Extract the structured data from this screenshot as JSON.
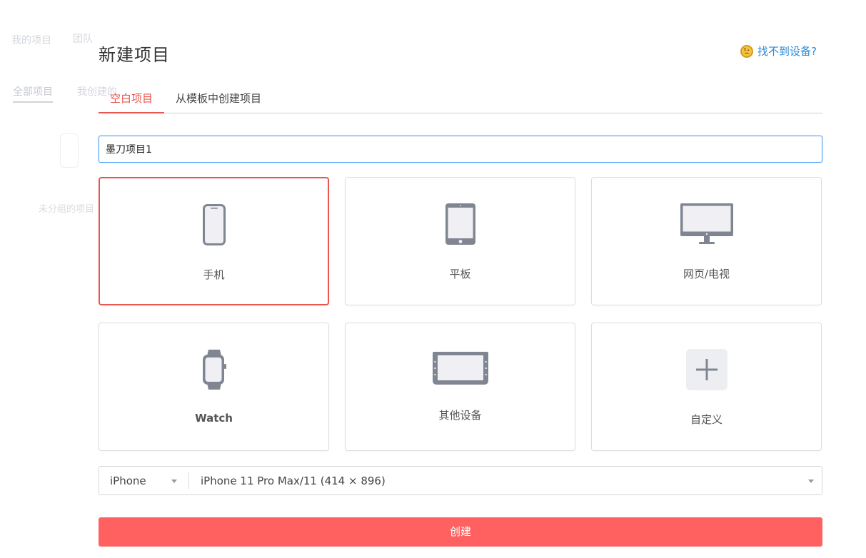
{
  "background": {
    "blurred_text_1": "我的项目",
    "blurred_text_2": "团队",
    "blurred_tab_1": "全部项目",
    "blurred_tab_2": "我创建的",
    "blurred_text_3": "未分组的项目"
  },
  "modal": {
    "title": "新建项目",
    "help_link": "找不到设备?",
    "help_icon": "thinking-face-emoji-icon"
  },
  "tabs": [
    {
      "label": "空白项目",
      "active": true
    },
    {
      "label": "从模板中创建项目",
      "active": false
    }
  ],
  "project_name": {
    "value": "墨刀项目1"
  },
  "devices": [
    {
      "label": "手机",
      "icon": "phone-icon",
      "selected": true
    },
    {
      "label": "平板",
      "icon": "tablet-icon",
      "selected": false
    },
    {
      "label": "网页/电视",
      "icon": "monitor-icon",
      "selected": false
    },
    {
      "label": "Watch",
      "icon": "watch-icon",
      "selected": false
    },
    {
      "label": "其他设备",
      "icon": "car-display-icon",
      "selected": false
    },
    {
      "label": "自定义",
      "icon": "plus-icon",
      "selected": false
    }
  ],
  "device_select": {
    "brand": "iPhone",
    "model": "iPhone 11 Pro Max/11 (414 × 896)"
  },
  "create_button": "创建",
  "colors": {
    "accent": "#e9554f",
    "button": "#ff6161",
    "link": "#2b8bd9",
    "focus_border": "#4a9ff5",
    "icon_gray": "#7f8591"
  }
}
